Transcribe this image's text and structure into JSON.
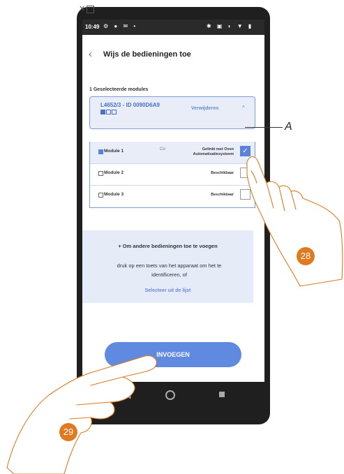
{
  "status_bar": {
    "time": "10:49",
    "left_icons": "⚙ ● ✉ •",
    "right_icons": "✱ ▣ ◐ ▼ ▮"
  },
  "header": {
    "title": "Wijs de bedieningen toe"
  },
  "selection": {
    "count_label": "1 Geselecteerde modules"
  },
  "device": {
    "id_label": "L4652/3 - ID 0090D6A9",
    "remove_label": "Verwijderen",
    "modules": [
      {
        "label": "Module 1",
        "code": "Co",
        "status_line1": "Gelinkt met Oven",
        "status_line2": "Automatisatiesysteem",
        "checked": true
      },
      {
        "label": "Module 2",
        "code": "",
        "status_line1": "Beschikbaar",
        "status_line2": "",
        "checked": false
      },
      {
        "label": "Module 3",
        "code": "",
        "status_line1": "Beschikbaar",
        "status_line2": "",
        "checked": false
      }
    ]
  },
  "info": {
    "title": "+ Om andere bedieningen toe te voegen",
    "text": "druk op een toets van het apparaat om het te identificeren, of",
    "link": "Selecteer uit de lijst"
  },
  "actions": {
    "insert_label": "INVOEGEN"
  },
  "annotations": {
    "letter": "A",
    "step1": "28",
    "step2": "29"
  },
  "colors": {
    "accent": "#5f8ae0",
    "callout": "#e07a20",
    "hand_stroke": "#e07a20"
  }
}
